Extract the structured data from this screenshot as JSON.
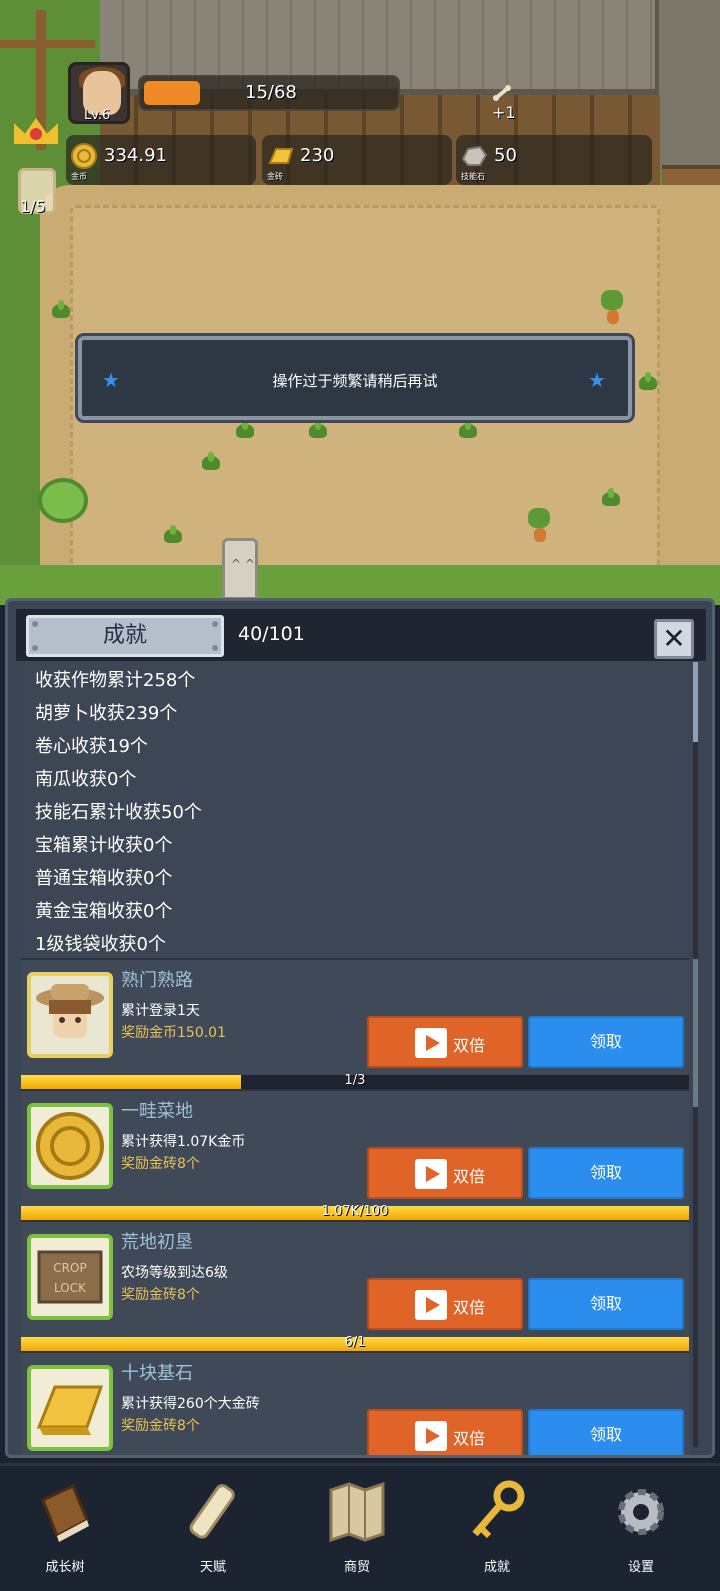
{
  "hud": {
    "level": "Lv.6",
    "xp_text": "15/68",
    "xp_fraction": 0.22,
    "bone_bonus": "+1",
    "gold": {
      "value": "334.91",
      "label": "金币"
    },
    "gold_brick": {
      "value": "230",
      "label": "金砖"
    },
    "skill_stone": {
      "value": "50",
      "label": "技能石"
    },
    "jar_text": "1/5"
  },
  "toast": {
    "message": "操作过于频繁请稍后再试"
  },
  "panel": {
    "title": "成就",
    "count": "40/101",
    "stats": [
      "收获作物累计258个",
      "胡萝卜收获239个",
      "卷心收获19个",
      "南瓜收获0个",
      "技能石累计收获50个",
      "宝箱累计收获0个",
      "普通宝箱收获0个",
      "黄金宝箱收获0个",
      "1级钱袋收获0个"
    ],
    "cards": [
      {
        "title": "熟门熟路",
        "desc": "累计登录1天",
        "reward": "奖励金币150.01",
        "double_label": "双倍",
        "claim_label": "领取",
        "progress_text": "1/3",
        "progress": 0.33
      },
      {
        "title": "一畦菜地",
        "desc": "累计获得1.07K金币",
        "reward": "奖励金砖8个",
        "double_label": "双倍",
        "claim_label": "领取",
        "progress_text": "1.07K/100",
        "progress": 1.0
      },
      {
        "title": "荒地初垦",
        "desc": "农场等级到达6级",
        "reward": "奖励金砖8个",
        "double_label": "双倍",
        "claim_label": "领取",
        "progress_text": "6/1",
        "progress": 1.0
      },
      {
        "title": "十块基石",
        "desc": "累计获得260个大金砖",
        "reward": "奖励金砖8个",
        "double_label": "双倍",
        "claim_label": "领取"
      }
    ]
  },
  "nav": [
    {
      "label": "成长树",
      "icon": "book-icon"
    },
    {
      "label": "天赋",
      "icon": "scroll-icon"
    },
    {
      "label": "商贸",
      "icon": "map-icon"
    },
    {
      "label": "成就",
      "icon": "key-icon"
    },
    {
      "label": "设置",
      "icon": "gear-icon"
    }
  ],
  "colors": {
    "accent_orange": "#e06428",
    "accent_blue": "#2b8ded",
    "progress_yellow": "#f1a800"
  }
}
